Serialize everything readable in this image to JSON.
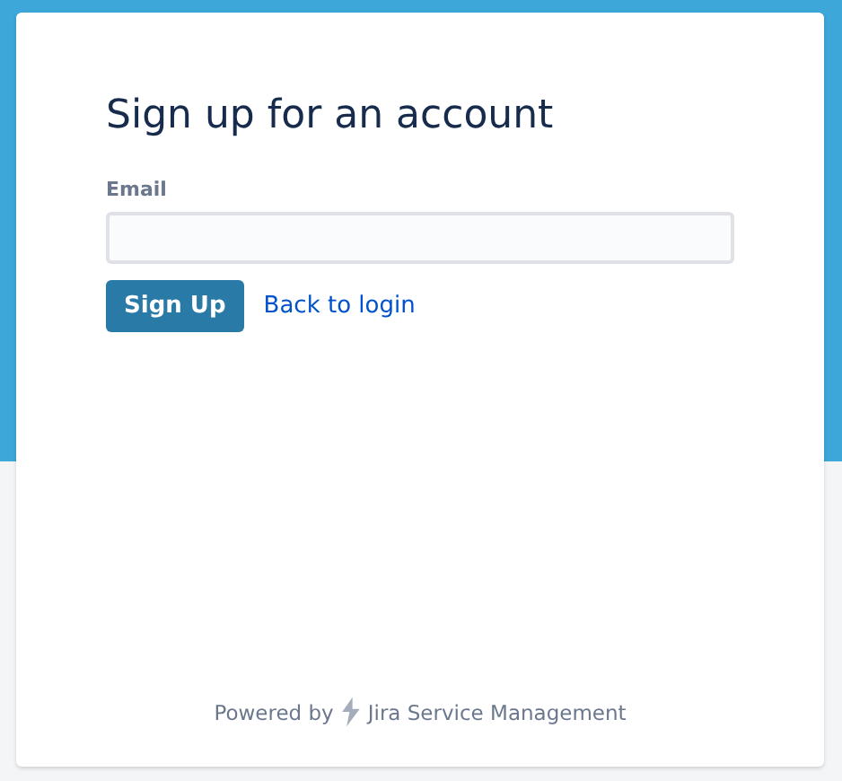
{
  "heading": "Sign up for an account",
  "form": {
    "email_label": "Email"
  },
  "buttons": [
    {
      "label": "Sign Up"
    }
  ],
  "links": [
    {
      "label": "Back to login"
    }
  ],
  "footer": {
    "prefix": "Powered by",
    "product": "Jira Service Management"
  }
}
